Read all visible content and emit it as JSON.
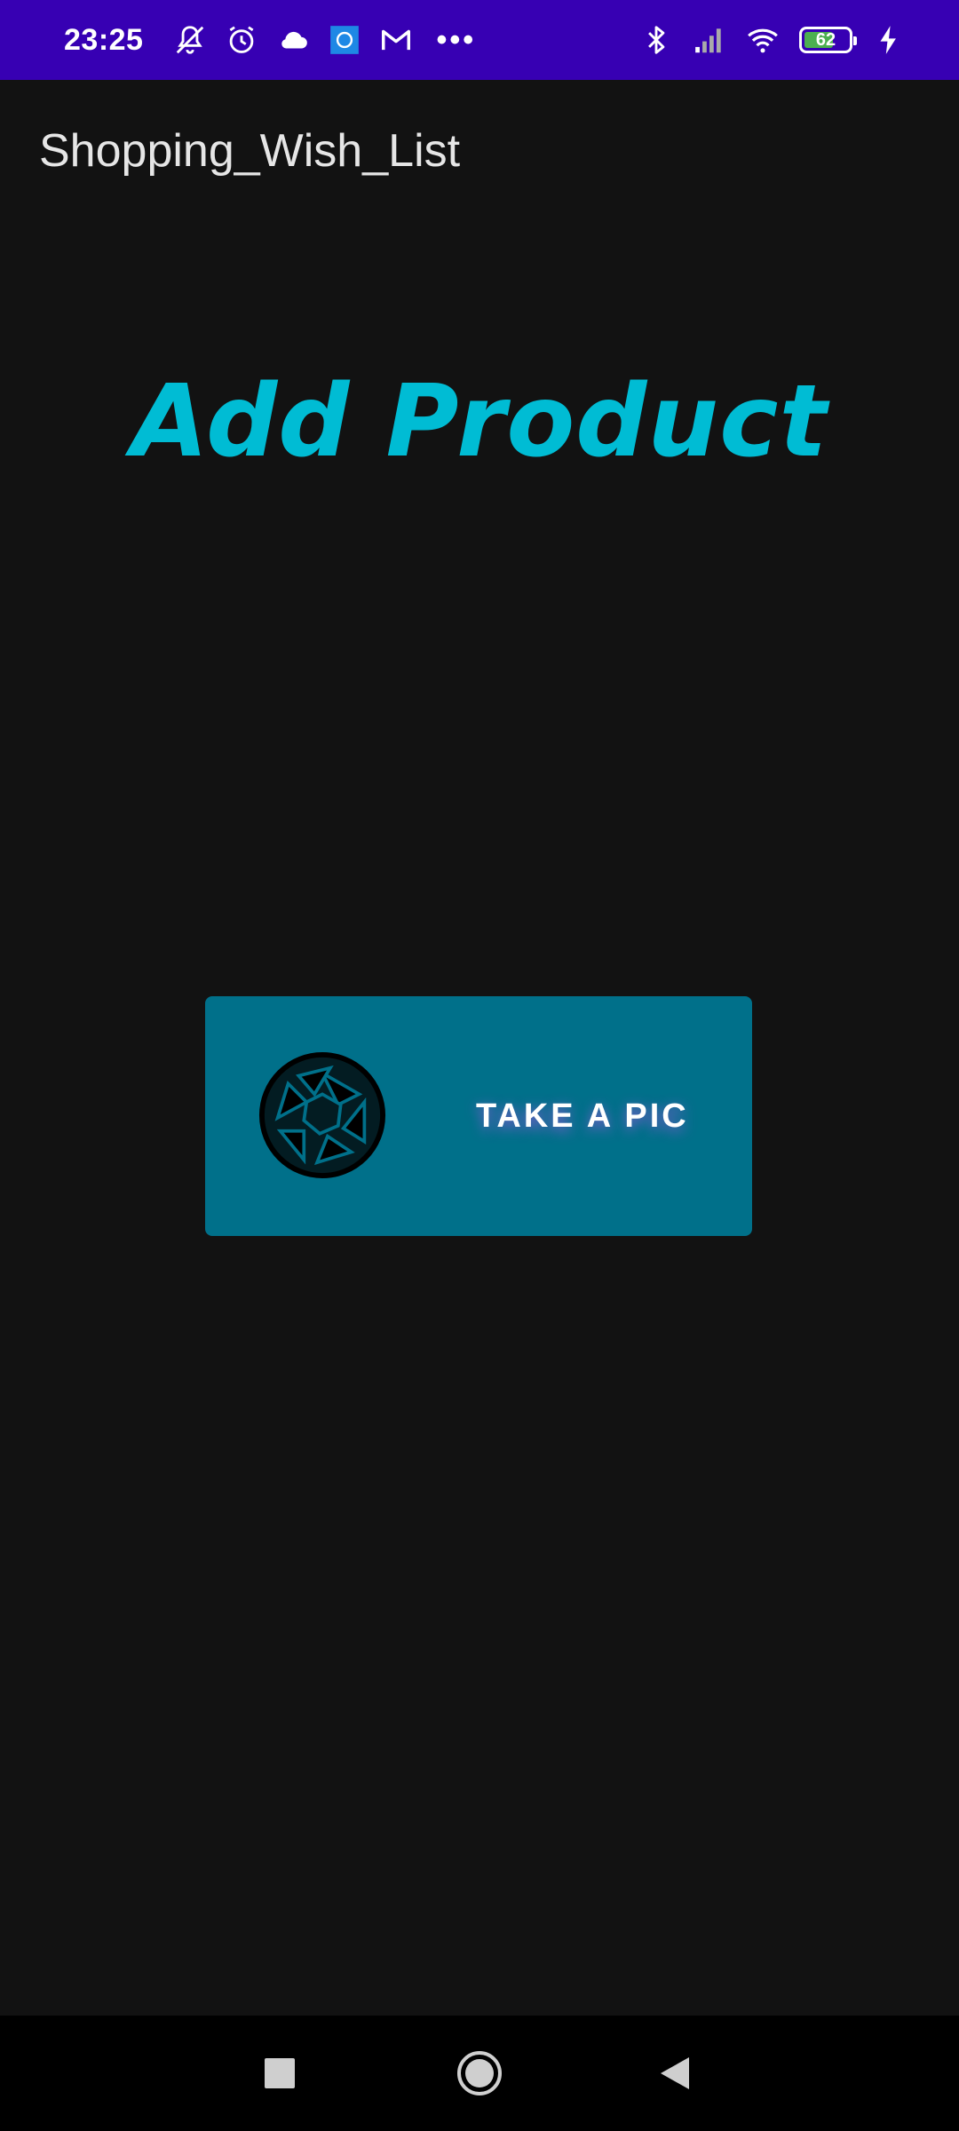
{
  "status_bar": {
    "time": "23:25",
    "battery_level": "62",
    "icons": [
      "muted-bell-icon",
      "alarm-icon",
      "cloud-icon",
      "app-badge-icon",
      "gmail-icon",
      "more-dots-icon",
      "bluetooth-icon",
      "signal-icon",
      "wifi-icon",
      "battery-icon",
      "charging-icon"
    ],
    "color": "#3700b3"
  },
  "app_bar": {
    "title": "Shopping_Wish_List"
  },
  "main": {
    "heading": "Add Product",
    "heading_color": "#00bcd4",
    "take_pic_button": {
      "label": "TAKE A PIC",
      "icon": "camera-shutter-icon",
      "color": "#00708a"
    }
  },
  "nav_bar": {
    "buttons": [
      "recent-apps-icon",
      "home-icon",
      "back-icon"
    ]
  }
}
